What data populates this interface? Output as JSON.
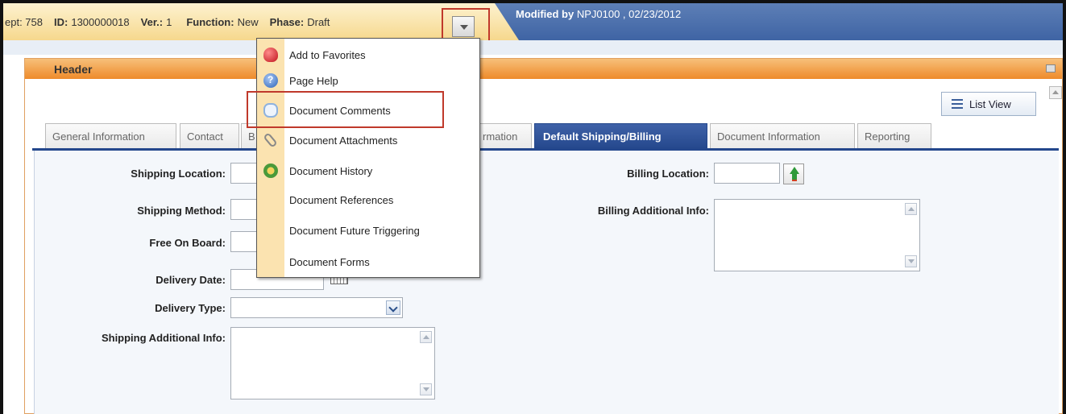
{
  "infobar": {
    "dept": "ept: 758",
    "id_label": "ID:",
    "id_value": "1300000018",
    "ver_label": "Ver.:",
    "ver_value": "1",
    "function_label": "Function:",
    "function_value": "New",
    "phase_label": "Phase:",
    "phase_value": "Draft",
    "modified_label": "Modified by",
    "modified_value": "NPJ0100 , 02/23/2012"
  },
  "panel": {
    "title": "Header",
    "list_view_label": "List View"
  },
  "tabs": [
    {
      "label": "General Information"
    },
    {
      "label": "Contact"
    },
    {
      "label": "B"
    },
    {
      "label": "rmation"
    },
    {
      "label": "Default Shipping/Billing",
      "active": true
    },
    {
      "label": "Document Information"
    },
    {
      "label": "Reporting"
    }
  ],
  "form": {
    "shipping_location": "Shipping Location:",
    "shipping_method": "Shipping Method:",
    "free_on_board": "Free On Board:",
    "delivery_date": "Delivery Date:",
    "delivery_type": "Delivery Type:",
    "shipping_additional_info": "Shipping Additional Info:",
    "billing_location": "Billing Location:",
    "billing_additional_info": "Billing Additional Info:"
  },
  "menu": {
    "items": [
      {
        "label": "Add to Favorites",
        "icon": "heart-icon"
      },
      {
        "label": "Page Help",
        "icon": "help-icon"
      },
      {
        "label": "Document Comments",
        "icon": "comment-icon"
      },
      {
        "label": "Document Attachments",
        "icon": "paperclip-icon"
      },
      {
        "label": "Document History",
        "icon": "history-icon"
      },
      {
        "label": "Document References",
        "icon": ""
      },
      {
        "label": "Document Future Triggering",
        "icon": ""
      },
      {
        "label": "Document Forms",
        "icon": ""
      }
    ]
  },
  "colors": {
    "accent_blue": "#24478c",
    "header_orange": "#ee8a2a",
    "highlight_red": "#c0392b",
    "menu_gutter": "#fbe3b0"
  }
}
